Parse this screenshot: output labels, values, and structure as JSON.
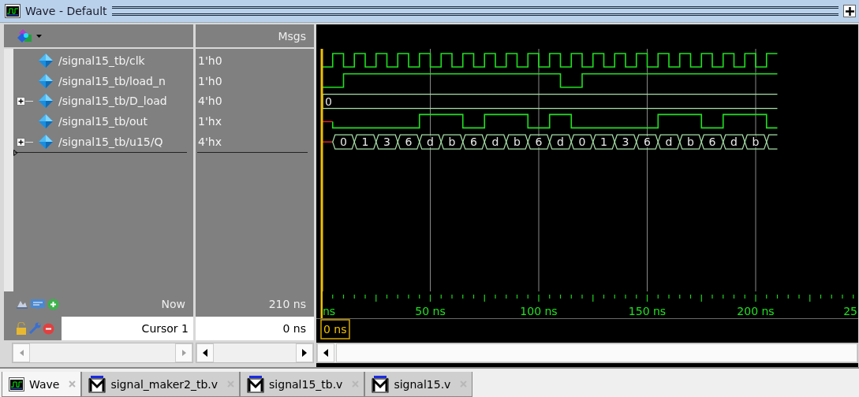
{
  "window": {
    "title": "Wave - Default"
  },
  "columns": {
    "values_header": "Msgs"
  },
  "signals": [
    {
      "name": "/signal15_tb/clk",
      "value": "1'h0",
      "kind": "clock"
    },
    {
      "name": "/signal15_tb/load_n",
      "value": "1'h0",
      "kind": "bit"
    },
    {
      "name": "/signal15_tb/D_load",
      "value": "4'h0",
      "kind": "bus",
      "expanded": false,
      "bus_values": [
        "0"
      ]
    },
    {
      "name": "/signal15_tb/out",
      "value": "1'hx",
      "kind": "bit"
    },
    {
      "name": "/signal15_tb/u15/Q",
      "value": "4'hx",
      "kind": "bus",
      "expanded": false,
      "bus_values": [
        "0",
        "1",
        "3",
        "6",
        "d",
        "b",
        "6",
        "d",
        "b",
        "6",
        "d",
        "0",
        "1",
        "3",
        "6",
        "d",
        "b",
        "6",
        "d",
        "b"
      ]
    }
  ],
  "now": {
    "label": "Now",
    "value": "210 ns"
  },
  "cursor": {
    "label": "Cursor 1",
    "value": "0 ns",
    "marker": "0 ns"
  },
  "ruler": {
    "labels": [
      "ns",
      "50 ns",
      "100 ns",
      "150 ns",
      "200 ns",
      "25"
    ]
  },
  "tabs": [
    {
      "label": "Wave",
      "kind": "wave",
      "selected": true
    },
    {
      "label": "signal_maker2_tb.v",
      "kind": "source",
      "selected": false
    },
    {
      "label": "signal15_tb.v",
      "kind": "source",
      "selected": false
    },
    {
      "label": "signal15.v",
      "kind": "source",
      "selected": false
    }
  ]
}
